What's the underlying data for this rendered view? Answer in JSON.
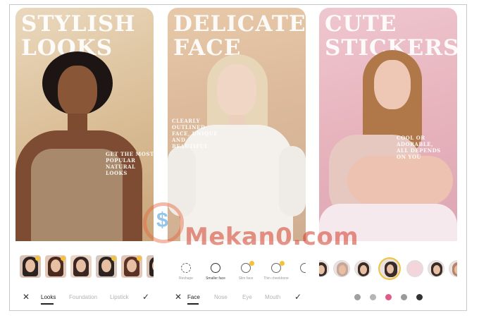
{
  "phones": [
    {
      "title_lines": [
        "STYLISH",
        "LOOKS"
      ],
      "side_text": "GET THE MOST POPULAR NATURAL LOOKS",
      "tabs": [
        "Looks",
        "Foundation",
        "Lipstick"
      ],
      "active_tab": "Looks",
      "thumb_count": 6
    },
    {
      "title_lines": [
        "DELICATE",
        "FACE"
      ],
      "side_text": "CLEARLY OUTLINED FACE, UNIQUE AND BEAUTIFUL",
      "tools": [
        "Reshape",
        "Smaller face",
        "Slim face",
        "Thin cheekbone"
      ],
      "tabs": [
        "Face",
        "Nose",
        "Eye",
        "Mouth"
      ],
      "active_tab": "Face"
    },
    {
      "title_lines": [
        "CUTE",
        "STICKERS"
      ],
      "side_text": "COOL OR ADORABLE, ALL DEPENDS ON YOU",
      "sticker_count": 8
    }
  ],
  "icons": {
    "close": "close-icon",
    "confirm": "check-icon"
  },
  "colors": {
    "accent_active": "#222222",
    "crown": "#f2c23a",
    "watermark": "#d23c28"
  },
  "watermark": {
    "text": "Mekan0.com"
  }
}
